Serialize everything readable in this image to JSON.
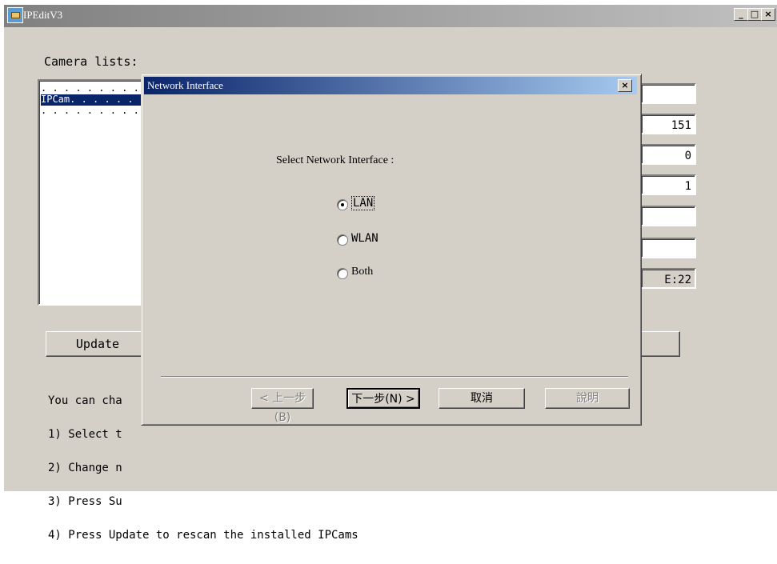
{
  "window": {
    "title": "IPEditV3"
  },
  "main": {
    "camera_list_label": "Camera lists:",
    "list_items": [
      ". . . . . . . . . . . . .",
      "IPCam. . . . . . .",
      ". . . . . . . . . . . . ."
    ],
    "selected_index": 1,
    "fields": [
      "",
      "151",
      "0",
      "1",
      "",
      "",
      "E:22"
    ],
    "update_label": "Update",
    "instructions": [
      "You can cha",
      "1) Select t",
      "2) Change n",
      "3) Press Su",
      "4) Press Update to rescan the installed IPCams"
    ]
  },
  "dialog": {
    "title": "Network Interface",
    "prompt": "Select Network Interface :",
    "options": [
      {
        "label": "LAN",
        "checked": true
      },
      {
        "label": "WLAN",
        "checked": false
      },
      {
        "label": "Both",
        "checked": false
      }
    ],
    "buttons": {
      "back": "< 上一步(B)",
      "next": "下一步(N) >",
      "cancel": "取消",
      "help": "說明"
    }
  }
}
